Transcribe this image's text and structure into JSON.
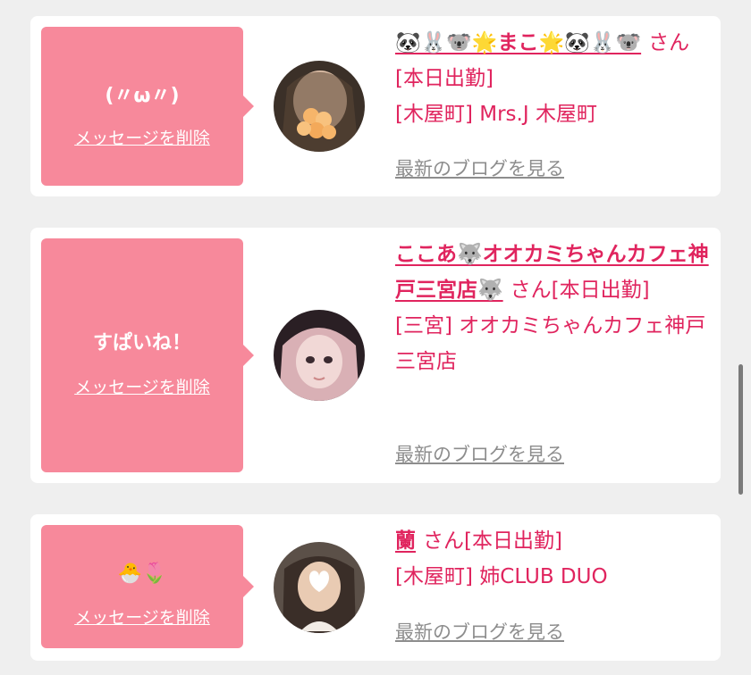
{
  "cards": [
    {
      "message": "(〃ω〃)",
      "delete_label": "メッセージを削除",
      "name": "🐼🐰🐨🌟まこ🌟🐼🐰🐨",
      "honorific": "さん",
      "status": "[本日出勤]",
      "shop": "[木屋町] Mrs.J 木屋町",
      "blog_link": "最新のブログを見る"
    },
    {
      "message": "すぱいね！",
      "delete_label": "メッセージを削除",
      "name": "ここあ🐺オオカミちゃんカフェ神戸三宮店🐺",
      "honorific": "さん",
      "status": "[本日出勤]",
      "shop": "[三宮] オオカミちゃんカフェ神戸三宮店",
      "blog_link": "最新のブログを見る"
    },
    {
      "message": "🐣🌷",
      "delete_label": "メッセージを削除",
      "name": "蘭",
      "honorific": "さん",
      "status": "[本日出勤]",
      "shop": "[木屋町] 姉CLUB DUO",
      "blog_link": "最新のブログを見る"
    }
  ],
  "colors": {
    "accent_pink": "#f7899b",
    "link_red": "#e0245e",
    "muted_gray": "#8d8d8d",
    "page_bg": "#efefef"
  }
}
